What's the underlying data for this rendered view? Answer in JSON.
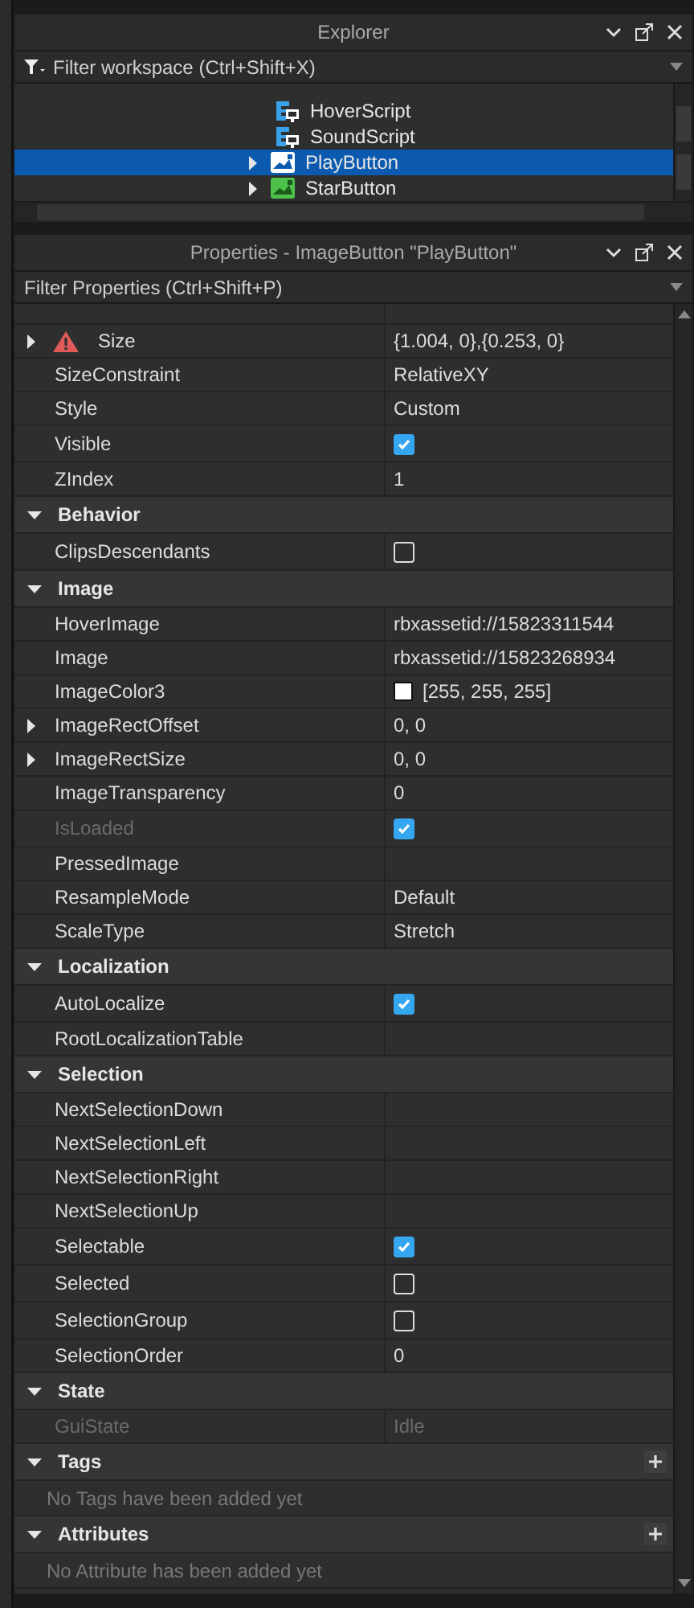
{
  "explorer": {
    "title": "Explorer",
    "filter_placeholder": "Filter workspace (Ctrl+Shift+X)",
    "items": [
      {
        "label": "HoverScript",
        "kind": "script",
        "selected": false,
        "expandable": false
      },
      {
        "label": "SoundScript",
        "kind": "script",
        "selected": false,
        "expandable": false
      },
      {
        "label": "PlayButton",
        "kind": "image",
        "selected": true,
        "expandable": true
      },
      {
        "label": "StarButton",
        "kind": "image",
        "selected": false,
        "expandable": true
      }
    ]
  },
  "properties": {
    "title": "Properties - ImageButton \"PlayButton\"",
    "filter_placeholder": "Filter Properties (Ctrl+Shift+P)",
    "sections": [
      {
        "rows": [
          {
            "name": "Size",
            "kind": "text",
            "value": "{1.004, 0},{0.253, 0}",
            "expandable": true,
            "warning": true
          },
          {
            "name": "SizeConstraint",
            "kind": "text",
            "value": "RelativeXY"
          },
          {
            "name": "Style",
            "kind": "text",
            "value": "Custom"
          },
          {
            "name": "Visible",
            "kind": "checkbox",
            "checked": true
          },
          {
            "name": "ZIndex",
            "kind": "text",
            "value": "1"
          }
        ]
      },
      {
        "title": "Behavior",
        "expanded": true,
        "rows": [
          {
            "name": "ClipsDescendants",
            "kind": "checkbox",
            "checked": false
          }
        ]
      },
      {
        "title": "Image",
        "expanded": true,
        "rows": [
          {
            "name": "HoverImage",
            "kind": "text",
            "value": "rbxassetid://15823311544"
          },
          {
            "name": "Image",
            "kind": "text",
            "value": "rbxassetid://15823268934"
          },
          {
            "name": "ImageColor3",
            "kind": "color",
            "color": "#ffffff",
            "value": "[255, 255, 255]"
          },
          {
            "name": "ImageRectOffset",
            "kind": "text",
            "value": "0, 0",
            "expandable": true
          },
          {
            "name": "ImageRectSize",
            "kind": "text",
            "value": "0, 0",
            "expandable": true
          },
          {
            "name": "ImageTransparency",
            "kind": "text",
            "value": "0"
          },
          {
            "name": "IsLoaded",
            "kind": "checkbox",
            "checked": true,
            "disabled": true
          },
          {
            "name": "PressedImage",
            "kind": "empty"
          },
          {
            "name": "ResampleMode",
            "kind": "text",
            "value": "Default"
          },
          {
            "name": "ScaleType",
            "kind": "text",
            "value": "Stretch"
          }
        ]
      },
      {
        "title": "Localization",
        "expanded": true,
        "rows": [
          {
            "name": "AutoLocalize",
            "kind": "checkbox",
            "checked": true
          },
          {
            "name": "RootLocalizationTable",
            "kind": "empty"
          }
        ]
      },
      {
        "title": "Selection",
        "expanded": true,
        "rows": [
          {
            "name": "NextSelectionDown",
            "kind": "empty"
          },
          {
            "name": "NextSelectionLeft",
            "kind": "empty"
          },
          {
            "name": "NextSelectionRight",
            "kind": "empty"
          },
          {
            "name": "NextSelectionUp",
            "kind": "empty"
          },
          {
            "name": "Selectable",
            "kind": "checkbox",
            "checked": true
          },
          {
            "name": "Selected",
            "kind": "checkbox",
            "checked": false
          },
          {
            "name": "SelectionGroup",
            "kind": "checkbox",
            "checked": false
          },
          {
            "name": "SelectionOrder",
            "kind": "text",
            "value": "0"
          }
        ]
      },
      {
        "title": "State",
        "expanded": true,
        "rows": [
          {
            "name": "GuiState",
            "kind": "text",
            "value": "Idle",
            "disabled": true
          }
        ]
      },
      {
        "title": "Tags",
        "expanded": true,
        "addable": true,
        "empty_message": "No Tags have been added yet"
      },
      {
        "title": "Attributes",
        "expanded": true,
        "addable": true,
        "empty_message": "No Attribute has been added yet"
      }
    ]
  }
}
